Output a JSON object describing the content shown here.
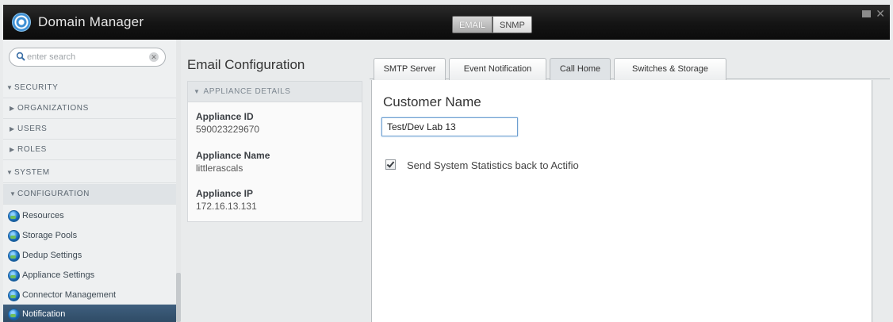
{
  "app": {
    "title": "Domain Manager",
    "mode_switch": {
      "active": "EMAIL",
      "inactive": "SNMP"
    }
  },
  "search": {
    "placeholder": "enter search"
  },
  "sidebar": {
    "security": "SECURITY",
    "organizations": "ORGANIZATIONS",
    "users": "USERS",
    "roles": "ROLES",
    "system": "SYSTEM",
    "configuration": "CONFIGURATION",
    "leaves": [
      "Resources",
      "Storage Pools",
      "Dedup Settings",
      "Appliance Settings",
      "Connector Management",
      "Notification"
    ]
  },
  "page": {
    "title": "Email Configuration"
  },
  "details": {
    "header": "APPLIANCE DETAILS",
    "appliance_id_label": "Appliance ID",
    "appliance_id": "590023229670",
    "appliance_name_label": "Appliance Name",
    "appliance_name": "littlerascals",
    "appliance_ip_label": "Appliance IP",
    "appliance_ip": "172.16.13.131"
  },
  "tabs": [
    "SMTP Server",
    "Event Notification",
    "Call Home",
    "Switches & Storage"
  ],
  "call_home": {
    "title": "Customer Name",
    "customer_name": "Test/Dev Lab 13",
    "checkbox_label": "Send System Statistics back to Actifio",
    "checkbox_checked": true
  },
  "colors": {
    "titlebar": "#141414",
    "selected_nav": "#2d4963",
    "input_focus": "#6e9fd0"
  }
}
